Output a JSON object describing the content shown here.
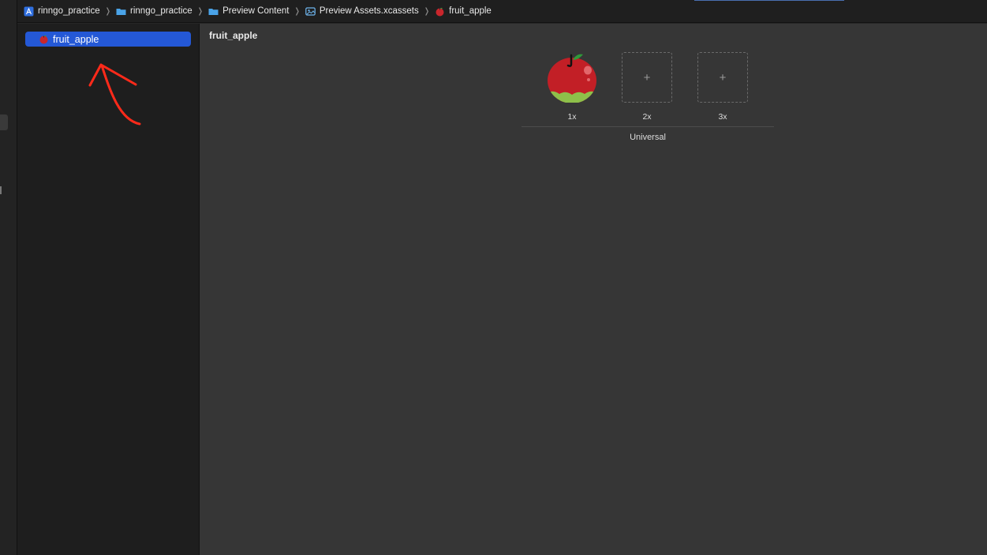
{
  "breadcrumb": [
    {
      "label": "rinngo_practice",
      "icon": "xcode-project-icon"
    },
    {
      "label": "rinngo_practice",
      "icon": "folder-icon"
    },
    {
      "label": "Preview Content",
      "icon": "folder-icon"
    },
    {
      "label": "Preview Assets.xcassets",
      "icon": "asset-catalog-icon"
    },
    {
      "label": "fruit_apple",
      "icon": "apple-image-icon"
    }
  ],
  "sidebar": {
    "selected_asset": "fruit_apple"
  },
  "editor": {
    "asset_name": "fruit_apple",
    "slots": [
      {
        "label": "1x",
        "filled": true
      },
      {
        "label": "2x",
        "filled": false,
        "placeholder": "+"
      },
      {
        "label": "3x",
        "filled": false,
        "placeholder": "+"
      }
    ],
    "group_label": "Universal"
  },
  "colors": {
    "selection": "#2458d6",
    "annotation_arrow": "#ff2a1a"
  }
}
